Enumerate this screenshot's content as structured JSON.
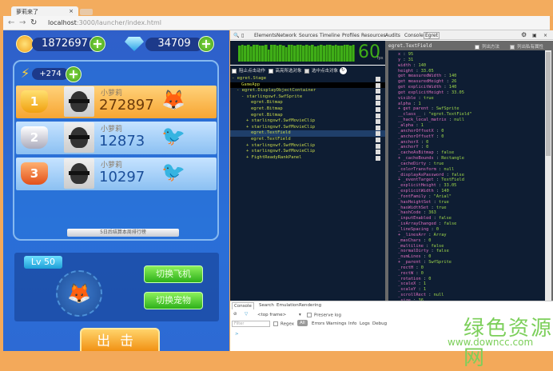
{
  "browser": {
    "tab_title": "萝莉来了",
    "tab_close": "×",
    "url_host": "localhost",
    "url_rest": ":3000/launcher/index.html"
  },
  "game": {
    "coins": "1872697",
    "gems": "34709",
    "energy": "+274",
    "ranking": [
      {
        "rank": "1",
        "name": "小萝莉",
        "score": "272897"
      },
      {
        "rank": "2",
        "name": "小萝莉",
        "score": "12873"
      },
      {
        "rank": "3",
        "name": "小萝莉",
        "score": "10297"
      }
    ],
    "notice": "5日后结算本周排行榜",
    "level": "Lv 50",
    "switch_plane": "切换飞机",
    "switch_pet": "切换宠物",
    "fight": "出击"
  },
  "devtools": {
    "tabs": [
      "Elements",
      "Network",
      "Sources",
      "Timeline",
      "Profiles",
      "Resources",
      "Audits",
      "Console",
      "Egret"
    ],
    "fps": "60",
    "fps_unit": "fps",
    "fps_bars": [
      90,
      95,
      92,
      96,
      88,
      94,
      97,
      93,
      90,
      95,
      70,
      94,
      96,
      92,
      95,
      93,
      80,
      96,
      94,
      91,
      95,
      97,
      92,
      94,
      90,
      96,
      85,
      93,
      95,
      92,
      94,
      96,
      91,
      95,
      93,
      90,
      94,
      96,
      92,
      95
    ],
    "options": [
      "阻止点击动作",
      "高亮所选对象",
      "选中点击对象"
    ],
    "tree": [
      {
        "label": "- egret.Stage",
        "indent": 0
      },
      {
        "label": "GameApp",
        "indent": 2,
        "state": "hover"
      },
      {
        "label": "- egret.DisplayObjectContainer",
        "indent": 1
      },
      {
        "label": "- starlingswf.SwfSprite",
        "indent": 2
      },
      {
        "label": "egret.Bitmap",
        "indent": 4
      },
      {
        "label": "egret.Bitmap",
        "indent": 4
      },
      {
        "label": "egret.Bitmap",
        "indent": 4
      },
      {
        "label": "+ starlingswf.SwfMovieClip",
        "indent": 3
      },
      {
        "label": "+ starlingswf.SwfMovieClip",
        "indent": 3
      },
      {
        "label": "egret.TextField",
        "indent": 4,
        "state": "selected"
      },
      {
        "label": "egret.TextField",
        "indent": 4
      },
      {
        "label": "+ starlingswf.SwfMovieClip",
        "indent": 3
      },
      {
        "label": "+ starlingswf.SwfMovieClip",
        "indent": 3
      },
      {
        "label": "+ FightReadyRankPanel",
        "indent": 3
      }
    ],
    "props_title": "egret.TextField",
    "props_opts": [
      "列出方法",
      "列出私有属性"
    ],
    "props": [
      [
        "x",
        "95"
      ],
      [
        "y",
        "31"
      ],
      [
        "width",
        "140"
      ],
      [
        "height",
        "33.05"
      ],
      [
        "get measuredWidth",
        "140"
      ],
      [
        "get measuredHeight",
        "26"
      ],
      [
        "get explicitWidth",
        "140"
      ],
      [
        "get explicitHeight",
        "33.05"
      ],
      [
        "visible",
        "true"
      ],
      [
        "alpha",
        "1"
      ],
      [
        "+ get parent",
        "SwfSprite"
      ],
      [
        "__class__",
        "\"egret.TextField\""
      ],
      [
        "__hack_local_matrix",
        "null"
      ],
      [
        "_alpha",
        "1"
      ],
      [
        "_anchorOffsetX",
        "0"
      ],
      [
        "_anchorOffsetY",
        "0"
      ],
      [
        "_anchorX",
        "0"
      ],
      [
        "_anchorY",
        "0"
      ],
      [
        "_cacheAsBitmap",
        "false"
      ],
      [
        "+ _cacheBounds",
        "Rectangle"
      ],
      [
        "_cacheDirty",
        "true"
      ],
      [
        "_colorTransform",
        "null"
      ],
      [
        "_displayAsPassword",
        "false"
      ],
      [
        "+ _eventTarget",
        "TextField"
      ],
      [
        "_explicitHeight",
        "33.05"
      ],
      [
        "_explicitWidth",
        "140"
      ],
      [
        "_fontFamily",
        "\"Arial\""
      ],
      [
        "_hasHeightSet",
        "true"
      ],
      [
        "_hasWidthSet",
        "true"
      ],
      [
        "_hashCode",
        "363"
      ],
      [
        "_inputEnabled",
        "false"
      ],
      [
        "_isArrayChanged",
        "false"
      ],
      [
        "_lineSpacing",
        "0"
      ],
      [
        "+ _linesArr",
        "Array"
      ],
      [
        "_maxChars",
        "0"
      ],
      [
        "_multiline",
        "false"
      ],
      [
        "_normalDirty",
        "false"
      ],
      [
        "_numLines",
        "0"
      ],
      [
        "+ _parent",
        "SwfSprite"
      ],
      [
        "_rectH",
        "0"
      ],
      [
        "_rectW",
        "0"
      ],
      [
        "_rotation",
        "0"
      ],
      [
        "_scaleX",
        "1"
      ],
      [
        "_scaleY",
        "1"
      ],
      [
        "_scrollRect",
        "null"
      ],
      [
        "_size",
        "36"
      ]
    ],
    "console": {
      "tabs": [
        "Console",
        "Search",
        "Emulation",
        "Rendering"
      ],
      "frame": "<top frame>",
      "preserve": "Preserve log",
      "filter_placeholder": "Filter",
      "regex": "Regex",
      "all": "All",
      "levels": [
        "Errors",
        "Warnings",
        "Info",
        "Logs",
        "Debug"
      ],
      "prompt": ">"
    }
  },
  "watermark": {
    "cn": "绿色资源网",
    "url": "www.downcc.com"
  }
}
